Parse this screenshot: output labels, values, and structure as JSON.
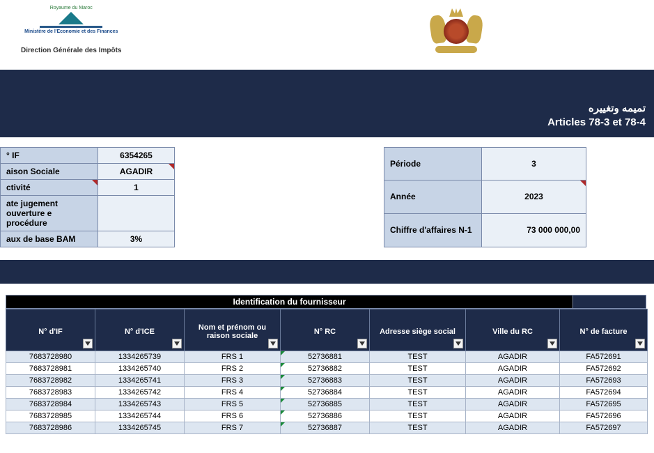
{
  "header": {
    "kingdom": "Royaume du Maroc",
    "ministry": "Ministère de l'Economie et des Finances",
    "direction": "Direction Générale des Impôts"
  },
  "title": {
    "line1_ar": "تميمه وتغييره",
    "line2": "Articles 78-3 et 78-4"
  },
  "info_left": {
    "if_label": "° IF",
    "if_value": "6354265",
    "raison_label": "aison Sociale",
    "raison_value": "AGADIR",
    "activite_label": "ctivité",
    "activite_value": "1",
    "date_jug_label": "ate jugement ouverture e procédure",
    "date_jug_value": "",
    "taux_label": "aux de base BAM",
    "taux_value": "3%"
  },
  "info_right": {
    "periode_label": "Période",
    "periode_value": "3",
    "annee_label": "Année",
    "annee_value": "2023",
    "ca_label": "Chiffre d'affaires N-1",
    "ca_value": "73 000 000,00"
  },
  "grid": {
    "section_title": "Identification du fournisseur",
    "columns": {
      "if": "N° d'IF",
      "ice": "N° d'ICE",
      "nom": "Nom et prénom ou raison sociale",
      "rc": "N° RC",
      "adresse": "Adresse siège social",
      "ville": "Ville du RC",
      "facture": "N° de facture"
    },
    "rows": [
      {
        "if": "7683728980",
        "ice": "1334265739",
        "nom": "FRS 1",
        "rc": "52736881",
        "adresse": "TEST",
        "ville": "AGADIR",
        "facture": "FA572691"
      },
      {
        "if": "7683728981",
        "ice": "1334265740",
        "nom": "FRS 2",
        "rc": "52736882",
        "adresse": "TEST",
        "ville": "AGADIR",
        "facture": "FA572692"
      },
      {
        "if": "7683728982",
        "ice": "1334265741",
        "nom": "FRS 3",
        "rc": "52736883",
        "adresse": "TEST",
        "ville": "AGADIR",
        "facture": "FA572693"
      },
      {
        "if": "7683728983",
        "ice": "1334265742",
        "nom": "FRS 4",
        "rc": "52736884",
        "adresse": "TEST",
        "ville": "AGADIR",
        "facture": "FA572694"
      },
      {
        "if": "7683728984",
        "ice": "1334265743",
        "nom": "FRS 5",
        "rc": "52736885",
        "adresse": "TEST",
        "ville": "AGADIR",
        "facture": "FA572695"
      },
      {
        "if": "7683728985",
        "ice": "1334265744",
        "nom": "FRS 6",
        "rc": "52736886",
        "adresse": "TEST",
        "ville": "AGADIR",
        "facture": "FA572696"
      },
      {
        "if": "7683728986",
        "ice": "1334265745",
        "nom": "FRS 7",
        "rc": "52736887",
        "adresse": "TEST",
        "ville": "AGADIR",
        "facture": "FA572697"
      }
    ]
  }
}
